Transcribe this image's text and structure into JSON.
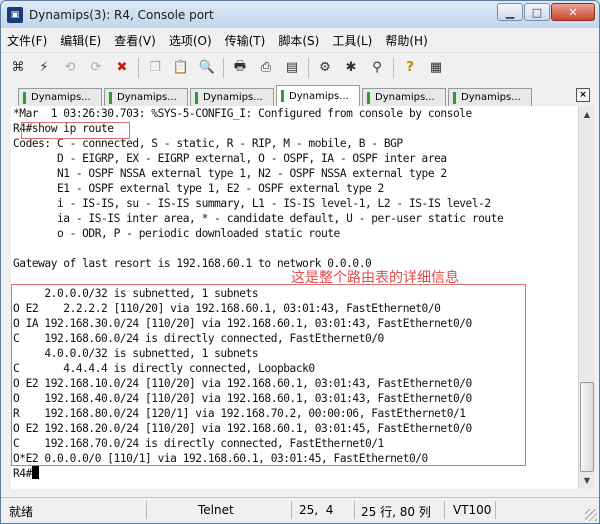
{
  "window": {
    "title": "Dynamips(3): R4, Console port",
    "minimize": "▁",
    "maximize": "□",
    "close": "✕"
  },
  "menu": [
    "文件(F)",
    "编辑(E)",
    "查看(V)",
    "选项(O)",
    "传输(T)",
    "脚本(S)",
    "工具(L)",
    "帮助(H)"
  ],
  "toolbar_icons": [
    "connect-icon",
    "quick-connect-icon",
    "reconnect-icon",
    "reconnect-all-icon",
    "disconnect-icon",
    "copy-icon",
    "paste-icon",
    "find-icon",
    "print-setup-icon",
    "print-icon",
    "print-screen-icon",
    "session-options-icon",
    "global-options-icon",
    "keymap-icon",
    "help-icon",
    "sftp-icon"
  ],
  "tabs": [
    {
      "label": "Dynamips...",
      "active": false
    },
    {
      "label": "Dynamips...",
      "active": false
    },
    {
      "label": "Dynamips...",
      "active": false
    },
    {
      "label": "Dynamips...",
      "active": true
    },
    {
      "label": "Dynamips...",
      "active": false
    },
    {
      "label": "Dynamips...",
      "active": false
    }
  ],
  "tab_close": "×",
  "terminal": {
    "lines": [
      "*Mar  1 03:26:30.703: %SYS-5-CONFIG_I: Configured from console by console",
      "R4#show ip route",
      "Codes: C - connected, S - static, R - RIP, M - mobile, B - BGP",
      "       D - EIGRP, EX - EIGRP external, O - OSPF, IA - OSPF inter area",
      "       N1 - OSPF NSSA external type 1, N2 - OSPF NSSA external type 2",
      "       E1 - OSPF external type 1, E2 - OSPF external type 2",
      "       i - IS-IS, su - IS-IS summary, L1 - IS-IS level-1, L2 - IS-IS level-2",
      "       ia - IS-IS inter area, * - candidate default, U - per-user static route",
      "       o - ODR, P - periodic downloaded static route",
      "",
      "Gateway of last resort is 192.168.60.1 to network 0.0.0.0",
      "",
      "     2.0.0.0/32 is subnetted, 1 subnets",
      "O E2    2.2.2.2 [110/20] via 192.168.60.1, 03:01:43, FastEthernet0/0",
      "O IA 192.168.30.0/24 [110/20] via 192.168.60.1, 03:01:43, FastEthernet0/0",
      "C    192.168.60.0/24 is directly connected, FastEthernet0/0",
      "     4.0.0.0/32 is subnetted, 1 subnets",
      "C       4.4.4.4 is directly connected, Loopback0",
      "O E2 192.168.10.0/24 [110/20] via 192.168.60.1, 03:01:43, FastEthernet0/0",
      "O    192.168.40.0/24 [110/20] via 192.168.60.1, 03:01:43, FastEthernet0/0",
      "R    192.168.80.0/24 [120/1] via 192.168.70.2, 00:00:06, FastEthernet0/1",
      "O E2 192.168.20.0/24 [110/20] via 192.168.60.1, 03:01:45, FastEthernet0/0",
      "C    192.168.70.0/24 is directly connected, FastEthernet0/1",
      "O*E2 0.0.0.0/0 [110/1] via 192.168.60.1, 03:01:45, FastEthernet0/0",
      "R4#"
    ],
    "annotation": "这是整个路由表的详细信息"
  },
  "status": {
    "state": "就绪",
    "protocol": "Telnet",
    "position": "25,  4",
    "size": "25 行, 80 列",
    "emulation": "VT100"
  }
}
